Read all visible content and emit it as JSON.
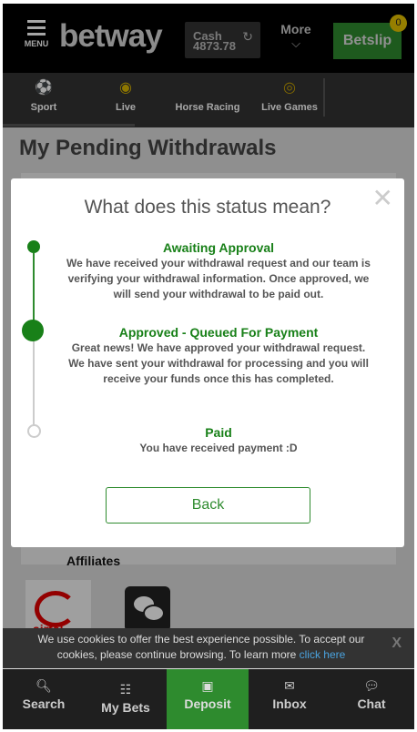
{
  "header": {
    "menu_label": "MENU",
    "logo": "betway",
    "cash_label": "Cash",
    "cash_amount": "4873.78",
    "more_label": "More",
    "betslip_label": "Betslip",
    "betslip_count": "0"
  },
  "nav": {
    "items": [
      {
        "label": "Sport",
        "icon": "soccer-ball-icon"
      },
      {
        "label": "Live",
        "icon": "live-icon"
      },
      {
        "label": "Horse Racing",
        "icon": "horse-icon"
      },
      {
        "label": "Live Games",
        "icon": "roulette-icon"
      }
    ]
  },
  "page": {
    "title": "My Pending Withdrawals",
    "affiliates_label": "Affiliates",
    "affiliate_logo_text": "airtel"
  },
  "modal": {
    "title": "What does this status mean?",
    "steps": [
      {
        "title": "Awaiting Approval",
        "desc": "We have received your withdrawal request and our team is verifying your withdrawal information. Once approved, we will send your withdrawal to be paid out."
      },
      {
        "title": "Approved - Queued For Payment",
        "desc": "Great news! We have approved your withdrawal request. We have sent your withdrawal for processing and you will receive your funds once this has completed."
      },
      {
        "title": "Paid",
        "desc": "You have received payment :D"
      }
    ],
    "back_label": "Back"
  },
  "cookie": {
    "text": "We use cookies to offer the best experience possible. To accept our cookies, please continue browsing. To learn more ",
    "link": "click here",
    "close": "X"
  },
  "bottom_nav": {
    "items": [
      {
        "label": "Search",
        "icon": "search-icon"
      },
      {
        "label": "My Bets",
        "icon": "bets-icon"
      },
      {
        "label": "Deposit",
        "icon": "cash-icon"
      },
      {
        "label": "Inbox",
        "icon": "envelope-icon"
      },
      {
        "label": "Chat",
        "icon": "chat-icon"
      }
    ]
  },
  "colors": {
    "brand_green": "#2e8b2e",
    "status_green": "#188018",
    "badge_yellow": "#e6c200"
  }
}
